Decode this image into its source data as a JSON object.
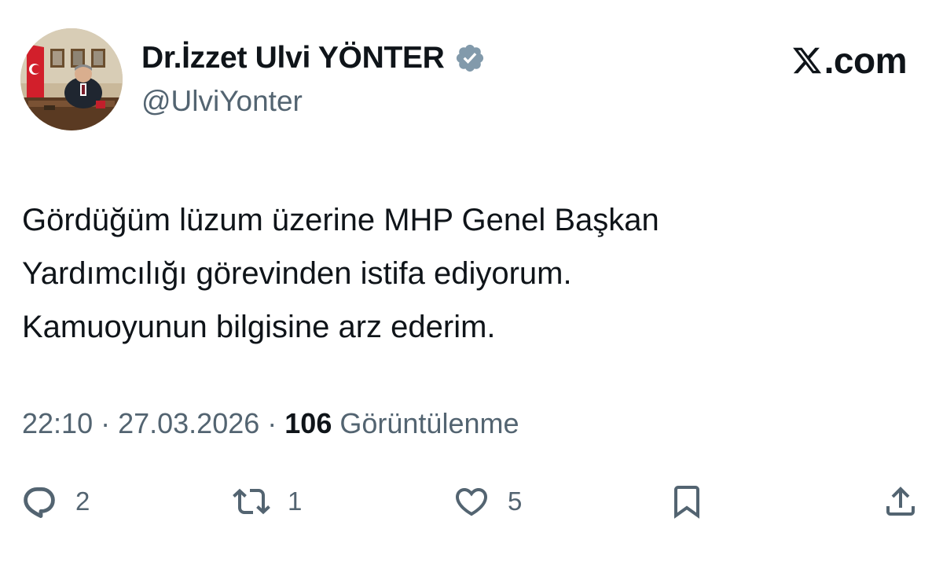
{
  "author": {
    "display_name": "Dr.İzzet Ulvi YÖNTER",
    "handle": "@UlviYonter",
    "verified": true,
    "verified_color": "#829aab"
  },
  "site": {
    "label": ".com"
  },
  "tweet": {
    "lines": [
      "Gördüğüm lüzum üzerine MHP Genel Başkan",
      "Yardımcılığı görevinden istifa ediyorum.",
      "Kamuoyunun bilgisine arz ederim."
    ]
  },
  "meta": {
    "time": "22:10",
    "date": "27.03.2026",
    "separator": " · ",
    "views_count": "106",
    "views_label": "Görüntülenme"
  },
  "actions": {
    "reply": {
      "icon": "reply-icon",
      "count": "2"
    },
    "repost": {
      "icon": "repost-icon",
      "count": "1"
    },
    "like": {
      "icon": "heart-icon",
      "count": "5"
    },
    "bookmark": {
      "icon": "bookmark-icon"
    },
    "share": {
      "icon": "share-icon"
    }
  },
  "colors": {
    "text_primary": "#0f1419",
    "text_secondary": "#536471"
  }
}
